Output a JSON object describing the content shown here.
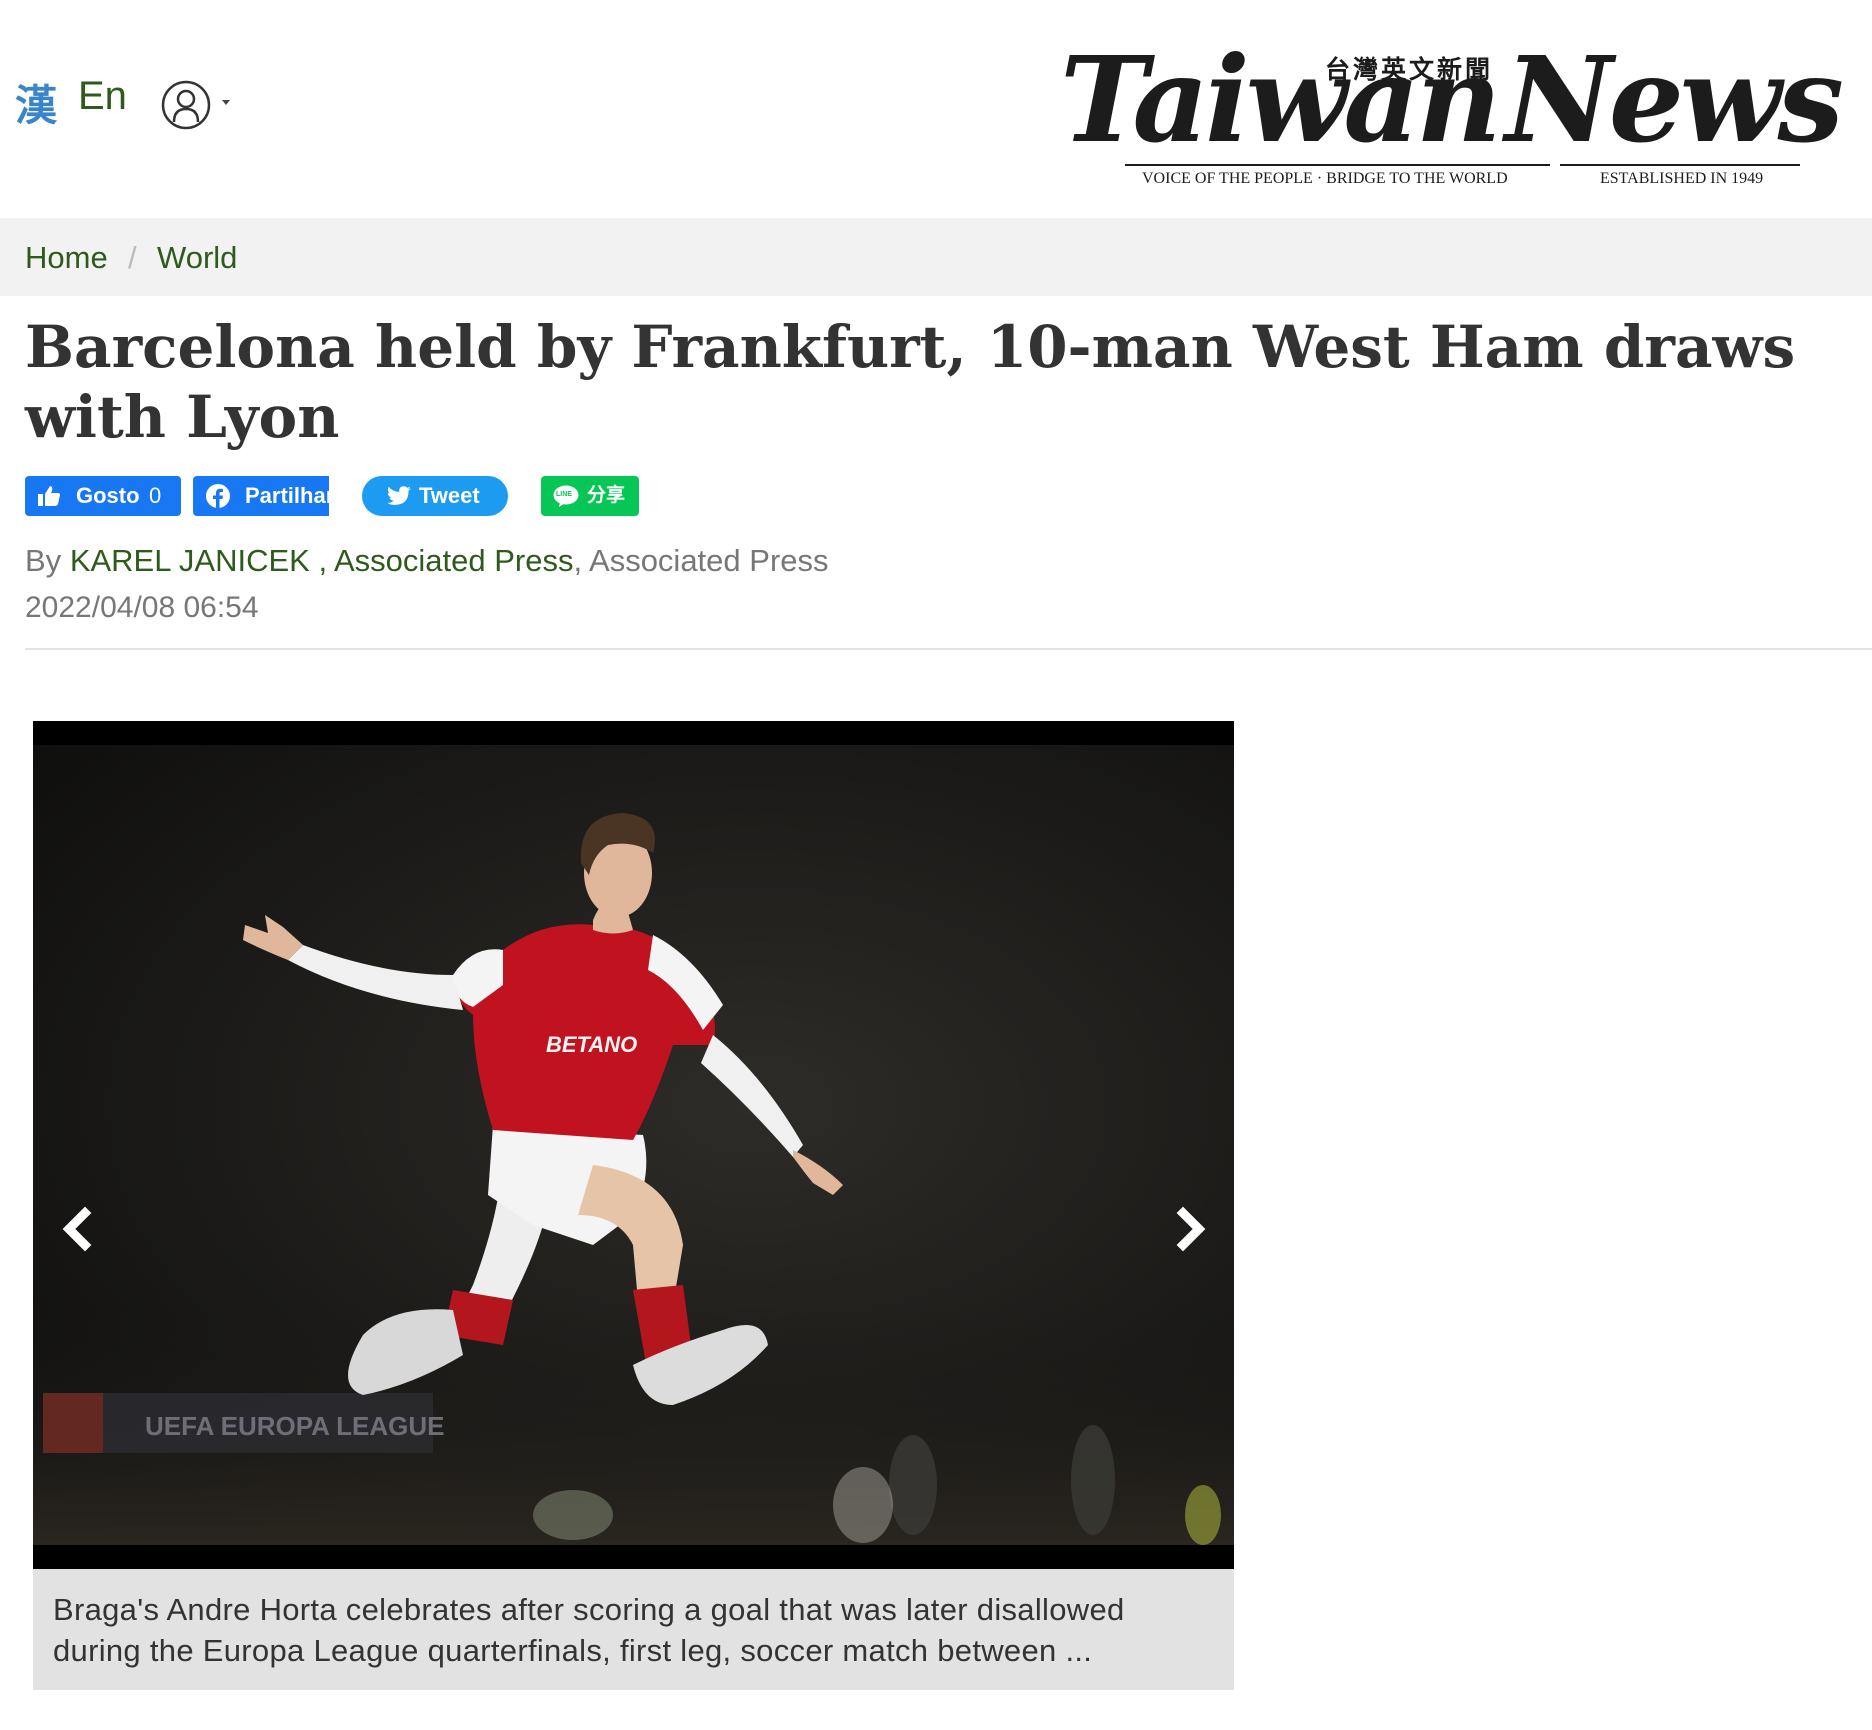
{
  "header": {
    "lang_zh": "漢",
    "lang_en": "En",
    "logo": {
      "word1": "Taiwan",
      "word2": "News",
      "cjk": "台灣英文新聞",
      "tagline_left": "VOICE OF THE PEOPLE · BRIDGE TO THE WORLD",
      "tagline_right": "ESTABLISHED IN 1949"
    }
  },
  "breadcrumb": {
    "home": "Home",
    "separator": "/",
    "section": "World"
  },
  "article": {
    "title": "Barcelona held by Frankfurt, 10-man West Ham draws with Lyon",
    "by": "By",
    "author": "KAREL JANICEK",
    "author_sep": " , ",
    "agency_link": "Associated Press",
    "agency_text": ", Associated Press",
    "date": "2022/04/08 06:54"
  },
  "social": {
    "like_label": "Gosto",
    "like_count": "0",
    "share_label": "Partilhar",
    "tweet_label": "Tweet",
    "line_label": "分享",
    "line_badge": "LINE"
  },
  "photo": {
    "sponsor": "BETANO",
    "board": "UEFA EUROPA LEAGUE",
    "caption": "Braga's Andre Horta celebrates after scoring a goal that was later disallowed during the Europa League quarterfinals, first leg, soccer match between ..."
  },
  "colors": {
    "link_green": "#2e5a1c",
    "zh_blue": "#3a84c9",
    "facebook": "#1877f2",
    "twitter": "#1d9bf0",
    "line": "#06c755"
  }
}
